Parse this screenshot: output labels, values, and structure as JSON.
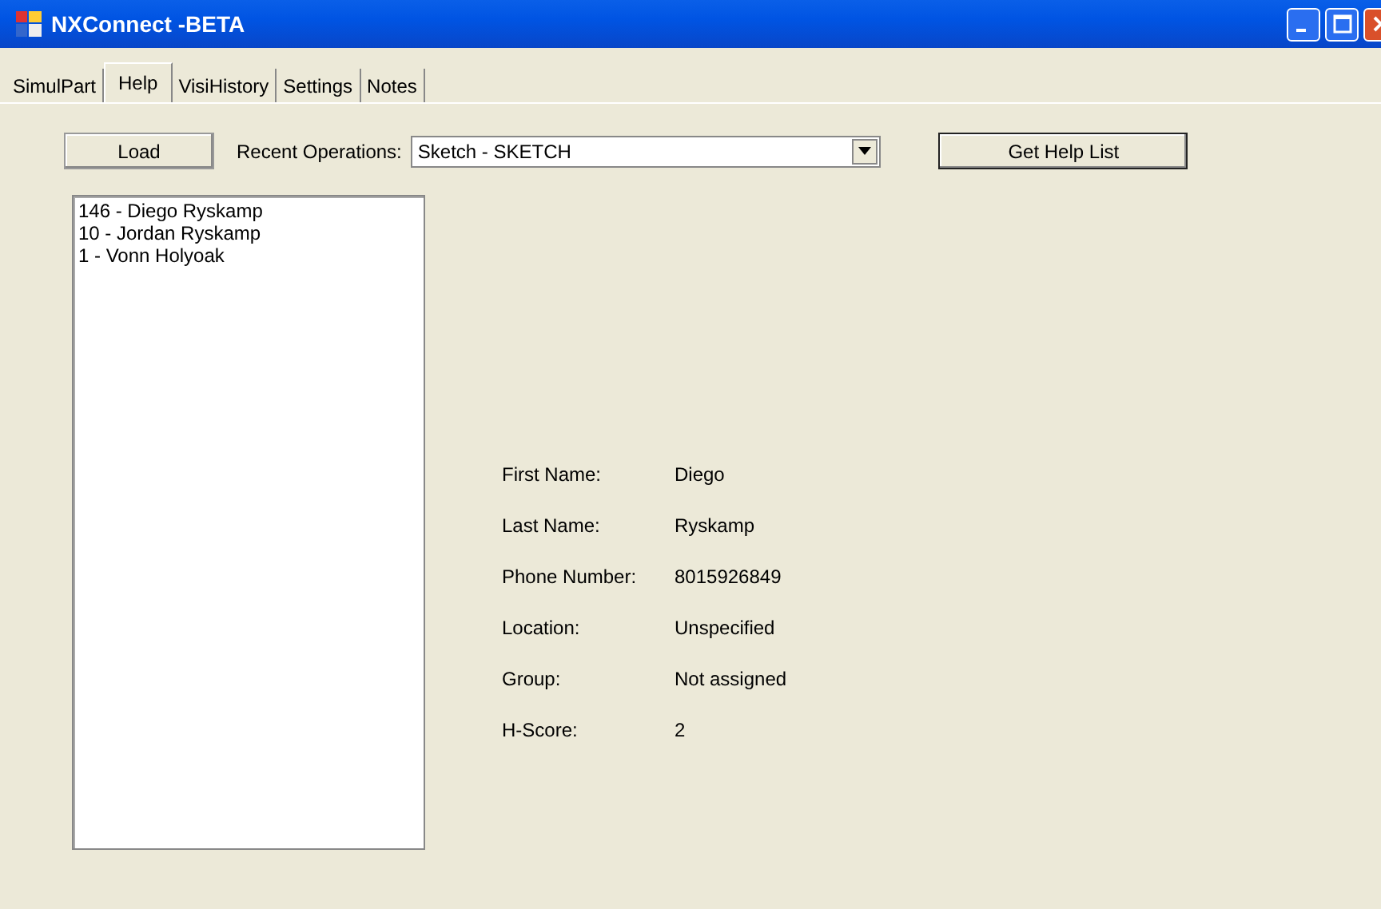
{
  "window": {
    "title": "NXConnect -BETA"
  },
  "tabs": [
    {
      "label": "SimulPart",
      "selected": false
    },
    {
      "label": "Help",
      "selected": true
    },
    {
      "label": "VisiHistory",
      "selected": false
    },
    {
      "label": "Settings",
      "selected": false
    },
    {
      "label": "Notes",
      "selected": false
    }
  ],
  "load_button": "Load",
  "recent_operations": {
    "label": "Recent Operations:",
    "value": "Sketch - SKETCH"
  },
  "get_help_list_button": "Get Help List",
  "people_list": [
    "146 - Diego Ryskamp",
    "10 - Jordan Ryskamp",
    "1 - Vonn Holyoak"
  ],
  "details": [
    {
      "label": "First Name:",
      "value": "Diego"
    },
    {
      "label": "Last Name:",
      "value": "Ryskamp"
    },
    {
      "label": "Phone Number:",
      "value": "8015926849"
    },
    {
      "label": "Location:",
      "value": "Unspecified"
    },
    {
      "label": "Group:",
      "value": "Not assigned"
    },
    {
      "label": "H-Score:",
      "value": "2"
    }
  ]
}
